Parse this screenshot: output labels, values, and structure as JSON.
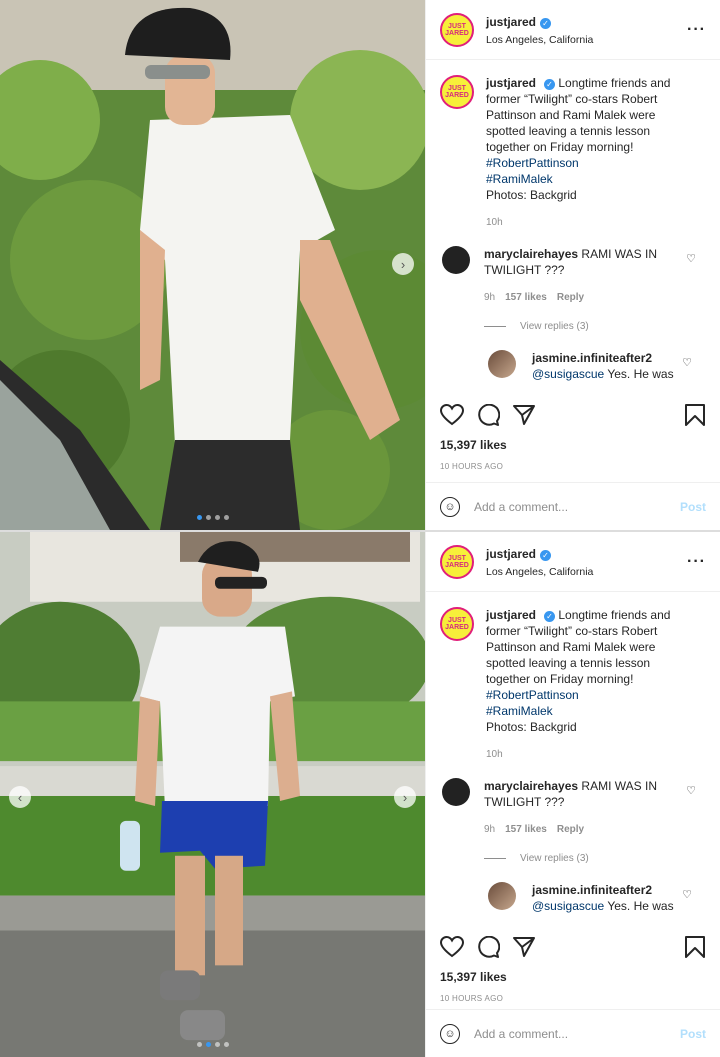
{
  "posts": [
    {
      "username": "justjared",
      "location": "Los Angeles, California",
      "avatar_text": "JUST JARED",
      "caption": {
        "username": "justjared",
        "text": "Longtime friends and former “Twilight” co-stars Robert Pattinson and Rami Malek were spotted leaving a tennis lesson together on Friday morning!",
        "hashtags": [
          "#RobertPattinson",
          "#RamiMalek"
        ],
        "credit": "Photos: Backgrid",
        "time": "10h"
      },
      "comment": {
        "username": "maryclairehayes",
        "text": "RAMI WAS IN TWILIGHT ???",
        "time": "9h",
        "likes": "157 likes",
        "reply_label": "Reply"
      },
      "view_replies": "View replies (3)",
      "reply": {
        "username": "jasmine.infiniteafter2",
        "mention": "@susigascue",
        "text": "Yes. He was"
      },
      "likes": "15,397 likes",
      "ago": "10 HOURS AGO",
      "add_comment_placeholder": "Add a comment...",
      "post_label": "Post"
    },
    {
      "username": "justjared",
      "location": "Los Angeles, California",
      "avatar_text": "JUST JARED",
      "caption": {
        "username": "justjared",
        "text": "Longtime friends and former “Twilight” co-stars Robert Pattinson and Rami Malek were spotted leaving a tennis lesson together on Friday morning!",
        "hashtags": [
          "#RobertPattinson",
          "#RamiMalek"
        ],
        "credit": "Photos: Backgrid",
        "time": "10h"
      },
      "comment": {
        "username": "maryclairehayes",
        "text": "RAMI WAS IN TWILIGHT ???",
        "time": "9h",
        "likes": "157 likes",
        "reply_label": "Reply"
      },
      "view_replies": "View replies (3)",
      "reply": {
        "username": "jasmine.infiniteafter2",
        "mention": "@susigascue",
        "text": "Yes. He was"
      },
      "likes": "15,397 likes",
      "ago": "10 HOURS AGO",
      "add_comment_placeholder": "Add a comment...",
      "post_label": "Post"
    }
  ],
  "icons": {
    "next": "chevron-right-icon",
    "prev": "chevron-left-icon",
    "heart": "heart-icon",
    "comment": "comment-icon",
    "share": "paper-plane-icon",
    "bookmark": "bookmark-icon",
    "emoji": "emoji-icon",
    "more": "more-icon",
    "verified": "verified-icon"
  },
  "colors": {
    "link": "#00376b",
    "meta": "#8e8e8e",
    "verified": "#3897f0",
    "post_disabled": "#b2dffc"
  }
}
